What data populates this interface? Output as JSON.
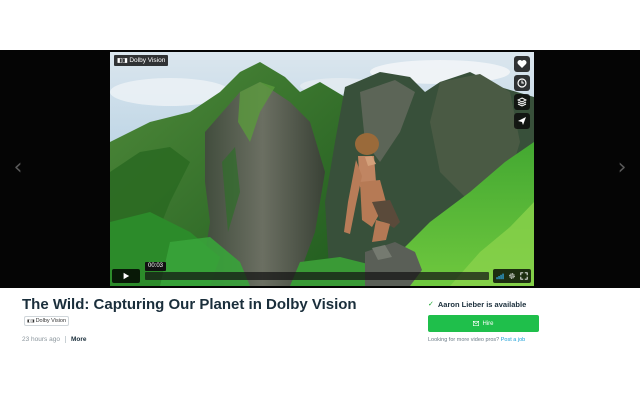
{
  "player": {
    "badge": {
      "icon": "dolby-logo-icon",
      "text": "Dolby Vision"
    },
    "side_actions": [
      "heart-icon",
      "clock-icon",
      "layers-icon",
      "send-icon"
    ],
    "controls": {
      "current_time": "00:03",
      "progress": 0.0,
      "icons": [
        "play-icon",
        "volume-bars-icon",
        "gear-icon",
        "fullscreen-icon"
      ]
    },
    "nav": {
      "prev": "‹",
      "next": "›"
    },
    "colors": {
      "band": "#050505",
      "sky": "#b8d2e4",
      "grass": "#2f8f2a",
      "rock": "#4b5148"
    }
  },
  "video_meta": {
    "title": "The Wild: Capturing Our Planet in Dolby Vision",
    "title_badge": "Dolby Vision",
    "uploaded": "23 hours ago",
    "more": "More"
  },
  "hire_panel": {
    "available_text": "Aaron Lieber is available",
    "button_label": "Hire",
    "looking_text": "Looking for more video pros?",
    "post_job_link": "Post a job",
    "colors": {
      "button": "#1fbf4b",
      "link": "#1a9fd8"
    }
  }
}
